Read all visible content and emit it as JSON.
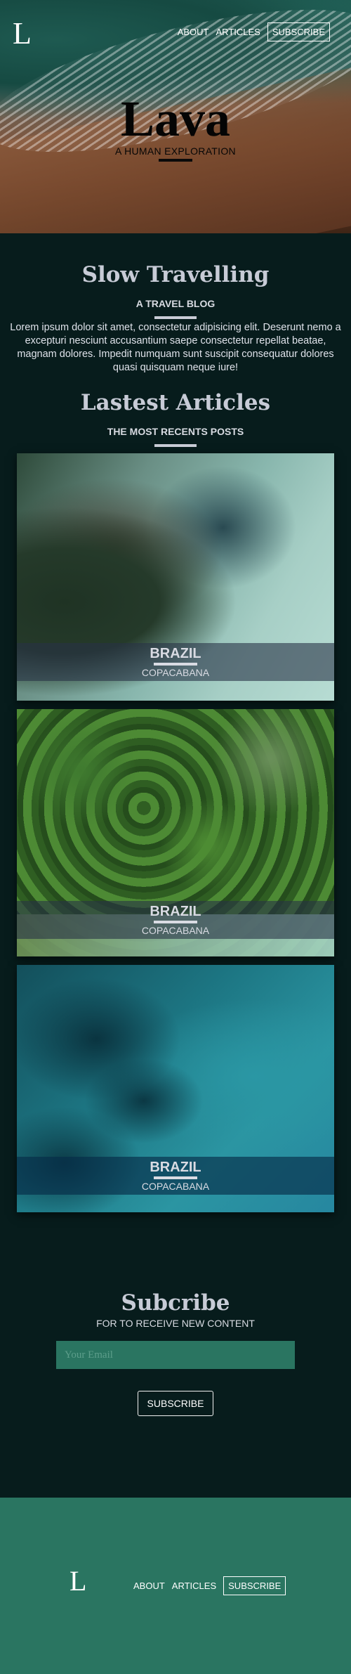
{
  "header": {
    "logo": "L",
    "nav": {
      "about": "ABOUT",
      "articles": "ARTICLES",
      "subscribe": "SUBSCRIBE"
    }
  },
  "hero": {
    "title": "Lava",
    "subtitle": "A HUMAN EXPLORATION"
  },
  "intro": {
    "title": "Slow Travelling",
    "subtitle": "A TRAVEL BLOG",
    "text": "Lorem ipsum dolor sit amet, consectetur adipisicing elit. Deserunt nemo a excepturi nesciunt accusantium saepe consectetur repellat beatae, magnam dolores. Impedit numquam sunt suscipit consequatur dolores quasi quisquam neque iure!"
  },
  "articles": {
    "title": "Lastest Articles",
    "subtitle": "THE MOST RECENTS POSTS",
    "cards": [
      {
        "country": "BRAZIL",
        "city": "COPACABANA"
      },
      {
        "country": "BRAZIL",
        "city": "COPACABANA"
      },
      {
        "country": "BRAZIL",
        "city": "COPACABANA"
      }
    ]
  },
  "subscribe": {
    "title": "Subcribe",
    "subtitle": "FOR TO RECEIVE NEW CONTENT",
    "email_placeholder": "Your Email",
    "button": "SUBSCRIBE"
  },
  "footer": {
    "logo": "L",
    "nav": {
      "about": "ABOUT",
      "articles": "ARTICLES",
      "subscribe": "SUBSCRIBE"
    }
  },
  "colors": {
    "background": "#071c1c",
    "accent": "#2a7561"
  }
}
